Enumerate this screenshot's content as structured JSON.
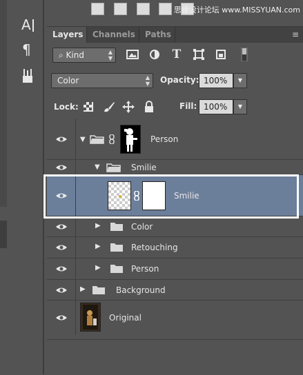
{
  "watermark": "思缘设计论坛 www.MISSYUAN.com",
  "panel": {
    "tabs": [
      {
        "label": "Layers",
        "active": true
      },
      {
        "label": "Channels",
        "active": false
      },
      {
        "label": "Paths",
        "active": false
      }
    ]
  },
  "filter": {
    "kind_label": "Kind"
  },
  "blend": {
    "mode": "Color",
    "opacity_label": "Opacity:",
    "opacity_value": "100%"
  },
  "lock": {
    "label": "Lock:",
    "fill_label": "Fill:",
    "fill_value": "100%"
  },
  "layers": [
    {
      "name": "Person",
      "type": "group-with-mask",
      "expanded": true,
      "visible": true
    },
    {
      "name": "Smilie",
      "type": "group",
      "expanded": true,
      "visible": true
    },
    {
      "name": "Smilie",
      "type": "layer-with-mask",
      "selected": true,
      "visible": true
    },
    {
      "name": "Color",
      "type": "group",
      "expanded": false,
      "visible": true
    },
    {
      "name": "Retouching",
      "type": "group",
      "expanded": false,
      "visible": true
    },
    {
      "name": "Person",
      "type": "group",
      "expanded": false,
      "visible": true
    },
    {
      "name": "Background",
      "type": "group",
      "expanded": false,
      "visible": true
    },
    {
      "name": "Original",
      "type": "image-layer",
      "visible": true
    }
  ],
  "colors": {
    "selected_row": "#6b7e9a",
    "panel_bg": "#535353",
    "highlight_border": "#ffffff"
  }
}
